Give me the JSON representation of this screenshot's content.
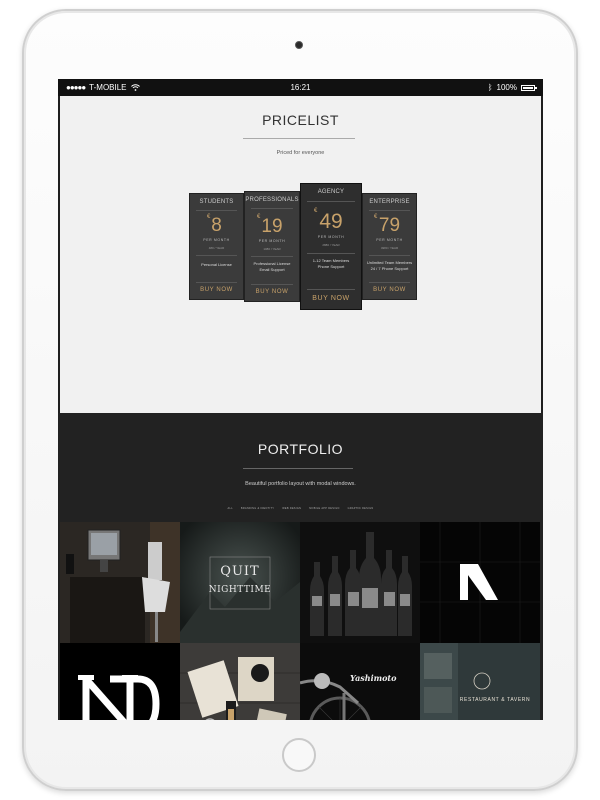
{
  "status_bar": {
    "carrier": "T-MOBILE",
    "time": "16:21",
    "battery": "100%"
  },
  "pricelist": {
    "title": "PRICELIST",
    "subtitle": "Priced for everyone",
    "plans": [
      {
        "name": "STUDENTS",
        "currency": "€",
        "price": "8",
        "period": "PER MONTH",
        "small": "480 / YEAR",
        "features": [
          "Personal License"
        ],
        "cta": "BUY NOW"
      },
      {
        "name": "PROFESSIONALS",
        "currency": "€",
        "price": "19",
        "period": "PER MONTH",
        "small": "1080 / YEAR",
        "features": [
          "Professional License",
          "Email Support"
        ],
        "cta": "BUY NOW"
      },
      {
        "name": "AGENCY",
        "currency": "€",
        "price": "49",
        "period": "PER MONTH",
        "small": "2880 / YEAR",
        "features": [
          "1-12 Team Members",
          "Phone Support"
        ],
        "cta": "BUY NOW"
      },
      {
        "name": "ENTERPRISE",
        "currency": "€",
        "price": "79",
        "period": "PER MONTH",
        "small": "4980 / YEAR",
        "features": [
          "Unlimited Team Members",
          "24 / 7 Phone Support"
        ],
        "cta": "BUY NOW"
      }
    ]
  },
  "portfolio": {
    "title": "PORTFOLIO",
    "subtitle": "Beautiful portfolio layout with modal windows.",
    "filters": [
      "ALL",
      "BRANDING & IDENTITY",
      "WEB DESIGN",
      "MOBILE APP DESIGN",
      "GRAPHIC DESIGN"
    ],
    "tiles": {
      "nightime_line1": "QUIT",
      "nightime_line2": "NIGHTTIME",
      "yashimoto": "Yashimoto",
      "restaurant": "RESTAURANT & TAVERN"
    }
  }
}
